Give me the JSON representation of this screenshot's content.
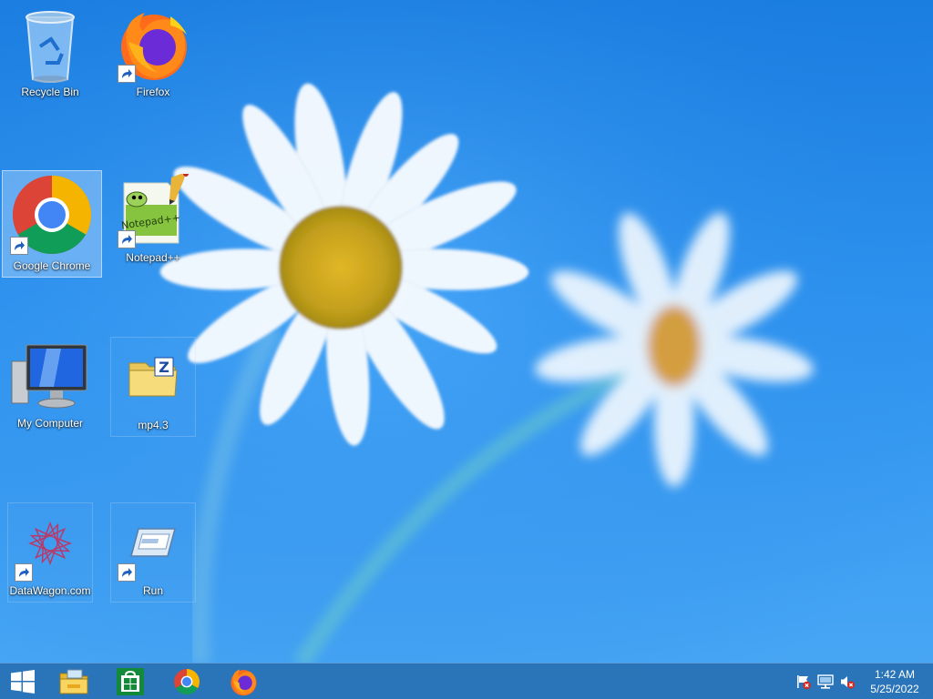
{
  "desktop": {
    "icons": [
      {
        "label": "Recycle Bin"
      },
      {
        "label": "Firefox"
      },
      {
        "label": "Google Chrome"
      },
      {
        "label": "Notepad++"
      },
      {
        "label": "My Computer"
      },
      {
        "label": "mp4.3"
      },
      {
        "label": "DataWagon.com"
      },
      {
        "label": "Run"
      }
    ]
  },
  "taskbar": {
    "pinned": [
      "start-icon",
      "file-explorer-icon",
      "store-icon",
      "chrome-icon",
      "firefox-icon"
    ],
    "tray": [
      "action-center-flag-icon",
      "network-icon",
      "volume-muted-icon"
    ],
    "clock": {
      "time": "1:42 AM",
      "date": "5/25/2022"
    }
  },
  "colors": {
    "wallpaper": "#2f94f0",
    "taskbar": "#2870b4",
    "selection": "#c8e1ff"
  }
}
